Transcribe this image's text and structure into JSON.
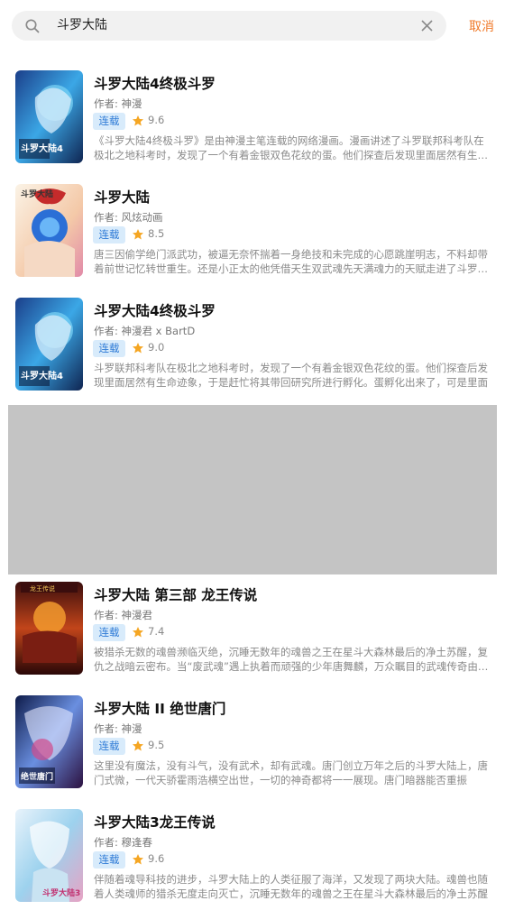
{
  "search": {
    "query": "斗罗大陆",
    "cancel_label": "取消"
  },
  "colors": {
    "accent": "#f07a2a",
    "tag_bg": "#d8ebfb",
    "tag_text": "#2f7bd6",
    "star": "#f5a623"
  },
  "results": [
    {
      "title": "斗罗大陆4终极斗罗",
      "author": "作者: 神漫",
      "status": "连载",
      "rating": "9.6",
      "description": "《斗罗大陆4终极斗罗》是由神漫主笔连载的网络漫画。漫画讲述了斗罗联邦科考队在极北之地科考时，发现了一个有着金银双色花纹的蛋。他们探查后发现里面居然有生命迹象",
      "cover_badge": "斗罗大陆4"
    },
    {
      "title": "斗罗大陆",
      "author": "作者: 风炫动画",
      "status": "连载",
      "rating": "8.5",
      "description": "唐三因偷学绝门派武功，被逼无奈怀揣着一身绝技和未完成的心愿跳崖明志，不料却带着前世记忆转世重生。还是小正太的他凭借天生双武魂先天满魂力的天赋走进了斗罗大陆",
      "cover_badge": "斗罗大陆"
    },
    {
      "title": "斗罗大陆4终极斗罗",
      "author": "作者: 神漫君 x BartD",
      "status": "连载",
      "rating": "9.0",
      "description": "斗罗联邦科考队在极北之地科考时，发现了一个有着金银双色花纹的蛋。他们探查后发现里面居然有生命迹象，于是赶忙将其带回研究所进行孵化。蛋孵化出来了，可是里面",
      "cover_badge": "斗罗大陆4"
    },
    {
      "title": "斗罗大陆 第三部 龙王传说",
      "author": "作者: 神漫君",
      "status": "连载",
      "rating": "7.4",
      "description": "被猎杀无数的魂兽濒临灭绝，沉睡无数年的魂兽之王在星斗大森林最后的净土苏醒，复仇之战暗云密布。当“废武魂”遇上执着而顽强的少年唐舞麟，万众瞩目的武魂传奇由此展开",
      "cover_badge": "龙王传说"
    },
    {
      "title": "斗罗大陆 II 绝世唐门",
      "author": "作者: 神漫",
      "status": "连载",
      "rating": "9.5",
      "description": "这里没有魔法，没有斗气，没有武术，却有武魂。唐门创立万年之后的斗罗大陆上，唐门式微，一代天骄霍雨浩横空出世，一切的神奇都将一一展现。唐门暗器能否重振",
      "cover_badge": "绝世唐门"
    },
    {
      "title": "斗罗大陆3龙王传说",
      "author": "作者: 穆逢春",
      "status": "连载",
      "rating": "9.6",
      "description": "伴随着魂导科技的进步，斗罗大陆上的人类征服了海洋，又发现了两块大陆。魂兽也随着人类魂师的猎杀无度走向灭亡，沉睡无数年的魂兽之王在星斗大森林最后的净土苏醒",
      "cover_badge": "斗罗大陆3"
    }
  ]
}
